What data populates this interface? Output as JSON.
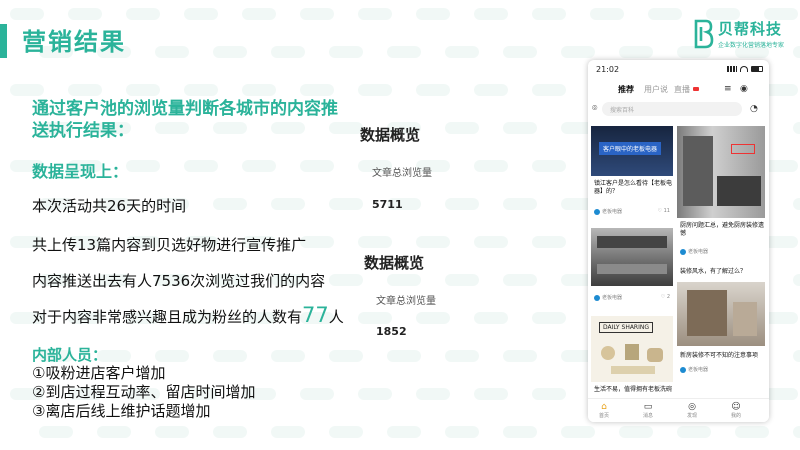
{
  "slide": {
    "title": "营销结果",
    "headline": "通过客户池的浏览量判断各城市的内容推送执行结果：",
    "data_heading": "数据呈现上：",
    "lines": [
      "本次活动共26天的时间",
      "共上传13篇内容到贝选好物进行宣传推广",
      "内容推送出去有人7536次浏览过我们的内容"
    ],
    "fans_prefix": "对于内容非常感兴趣且成为粉丝的人数有",
    "fans_count": "77",
    "fans_suffix": "人",
    "internal_title": "内部人员：",
    "internal_items": [
      "①吸粉进店客户增加",
      "②到店过程互动率、留店时间增加",
      "③离店后线上维护话题增加"
    ]
  },
  "logo": {
    "name": "贝帮科技",
    "tagline": "企业数字化营销落地专家"
  },
  "stats": [
    {
      "title": "数据概览",
      "label": "文章总浏览量",
      "value": "5711"
    },
    {
      "title": "数据概览",
      "label": "文章总浏览量",
      "value": "1852"
    }
  ],
  "phone": {
    "time": "21:02",
    "tabs": [
      "推荐",
      "用户说",
      "直播"
    ],
    "search_placeholder": "搜索百科",
    "cards": [
      {
        "banner": "客户眼中的老板电器",
        "title": "镇江客户是怎么看待【老板电器】的？",
        "author": "老板电器",
        "likes": "11"
      },
      {
        "title": "厨房问题汇总，避免厨房装修遗憾",
        "author": "老板电器",
        "likes": ""
      },
      {
        "title": "",
        "author": "老板电器",
        "likes": "2"
      },
      {
        "title": "装修风水，有了解过么？",
        "author": "老板电器",
        "likes": ""
      },
      {
        "banner": "DAILY SHARING",
        "title": "生活不易，值得拥有老板洗碗",
        "author": "",
        "likes": ""
      },
      {
        "title": "新房装修不可不知的注意事项",
        "author": "老板电器",
        "likes": ""
      }
    ],
    "nav": [
      "首页",
      "消息",
      "发现",
      "我的"
    ]
  },
  "colors": {
    "accent": "#2bb39a",
    "text": "#111111"
  }
}
